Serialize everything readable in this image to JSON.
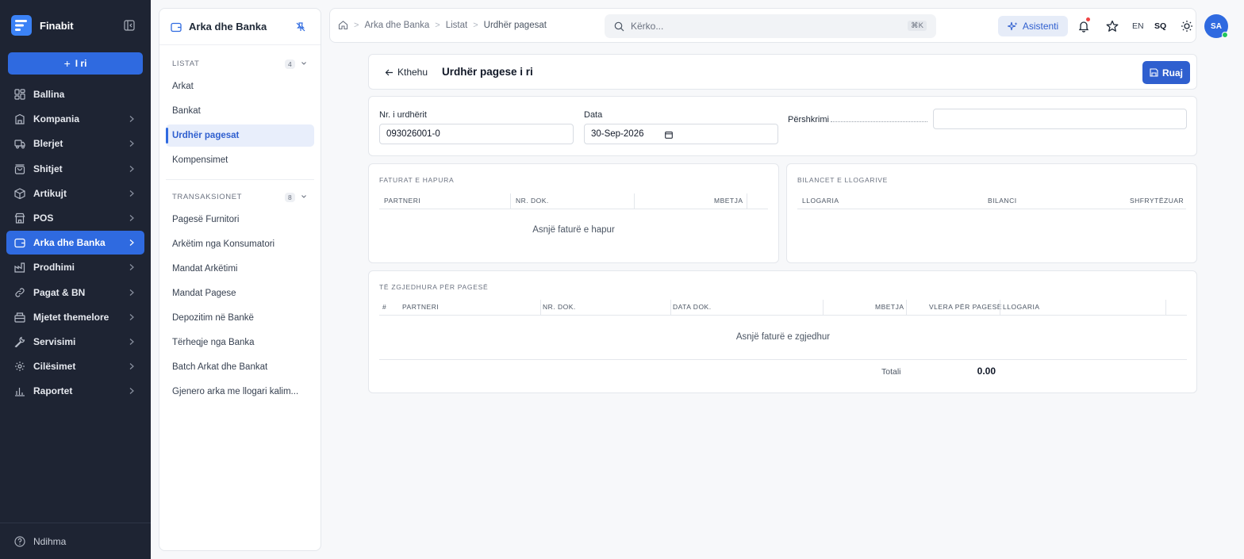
{
  "brand": {
    "name": "Finabit"
  },
  "sidebar": {
    "new_label": "I ri",
    "items": [
      {
        "label": "Ballina",
        "icon": "dashboard-icon",
        "chevron": false,
        "active": false
      },
      {
        "label": "Kompania",
        "icon": "building-icon",
        "chevron": true,
        "active": false
      },
      {
        "label": "Blerjet",
        "icon": "truck-icon",
        "chevron": true,
        "active": false
      },
      {
        "label": "Shitjet",
        "icon": "shopping-bag-icon",
        "chevron": true,
        "active": false
      },
      {
        "label": "Artikujt",
        "icon": "box-icon",
        "chevron": true,
        "active": false
      },
      {
        "label": "POS",
        "icon": "store-icon",
        "chevron": true,
        "active": false
      },
      {
        "label": "Arka dhe Banka",
        "icon": "wallet-icon",
        "chevron": true,
        "active": true
      },
      {
        "label": "Prodhimi",
        "icon": "factory-icon",
        "chevron": true,
        "active": false
      },
      {
        "label": "Pagat & BN",
        "icon": "link-icon",
        "chevron": true,
        "active": false
      },
      {
        "label": "Mjetet themelore",
        "icon": "assets-icon",
        "chevron": true,
        "active": false
      },
      {
        "label": "Servisimi",
        "icon": "wrench-icon",
        "chevron": true,
        "active": false
      },
      {
        "label": "Cilësimet",
        "icon": "gear-icon",
        "chevron": true,
        "active": false
      },
      {
        "label": "Raportet",
        "icon": "bar-chart-icon",
        "chevron": true,
        "active": false
      }
    ],
    "footer": "Ndihma"
  },
  "subpanel": {
    "title": "Arka dhe Banka",
    "sections": [
      {
        "label": "LISTAT",
        "count": "4",
        "items": [
          {
            "label": "Arkat",
            "active": false
          },
          {
            "label": "Bankat",
            "active": false
          },
          {
            "label": "Urdhër pagesat",
            "active": true
          },
          {
            "label": "Kompensimet",
            "active": false
          }
        ]
      },
      {
        "label": "TRANSAKSIONET",
        "count": "8",
        "items": [
          {
            "label": "Pagesë Furnitori",
            "active": false
          },
          {
            "label": "Arkëtim nga Konsumatori",
            "active": false
          },
          {
            "label": "Mandat Arkëtimi",
            "active": false
          },
          {
            "label": "Mandat Pagese",
            "active": false
          },
          {
            "label": "Depozitim në Bankë",
            "active": false
          },
          {
            "label": "Tërheqje nga Banka",
            "active": false
          },
          {
            "label": "Batch Arkat dhe Bankat",
            "active": false
          },
          {
            "label": "Gjenero arka me llogari kalim...",
            "active": false
          }
        ]
      }
    ]
  },
  "topbar": {
    "breadcrumb": [
      "Arka dhe Banka",
      "Listat",
      "Urdhër pagesat"
    ],
    "search_placeholder": "Kërko...",
    "search_shortcut": "⌘K",
    "assistant_label": "Asistenti",
    "lang_en": "EN",
    "lang_sq": "SQ",
    "avatar_initials": "SA"
  },
  "page": {
    "back_label": "Kthehu",
    "title": "Urdhër pagese i ri",
    "save_label": "Ruaj"
  },
  "form": {
    "order_no_label": "Nr. i urdhërit",
    "order_no_value": "093026001-0",
    "date_label": "Data",
    "date_value": "30-Sep-2026",
    "description_label": "Përshkrimi",
    "description_value": ""
  },
  "open_invoices": {
    "title": "FATURAT E HAPURA",
    "columns": [
      "PARTNERI",
      "NR. DOK.",
      "MBETJA"
    ],
    "empty": "Asnjë faturë e hapur"
  },
  "balances": {
    "title": "BILANCET E LLOGARIVE",
    "columns": [
      "LLOGARIA",
      "BILANCI",
      "SHFRYTËZUAR"
    ]
  },
  "selected": {
    "title": "TË ZGJEDHURA PËR PAGESË",
    "columns": [
      "#",
      "PARTNERI",
      "NR. DOK.",
      "DATA DOK.",
      "MBETJA",
      "VLERA PËR PAGESË",
      "LLOGARIA"
    ],
    "empty": "Asnjë faturë e zgjedhur",
    "total_label": "Totali",
    "total_value": "0.00"
  },
  "colors": {
    "accent": "#2f6ae0",
    "sidebar_bg": "#1e2433"
  }
}
